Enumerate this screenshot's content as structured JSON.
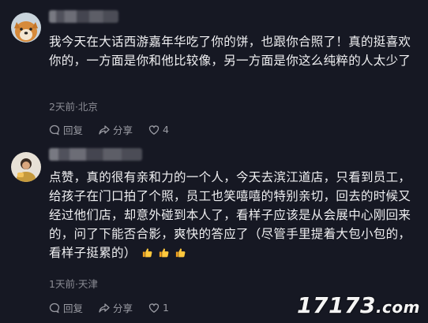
{
  "comments": [
    {
      "text": "我今天在大话西游嘉年华吃了你的饼，也跟你合照了！真的挺喜欢你的，一方面是你和他比较像，另一方面是你这么纯粹的人太少了",
      "meta": "2天前·北京",
      "reply_label": "回复",
      "share_label": "分享",
      "like_count": "4"
    },
    {
      "text": "点赞，真的很有亲和力的一个人，今天去滨江道店，只看到员工，给孩子在门口拍了个照，员工也笑嘻嘻的特别亲切，回去的时候又经过他们店，却意外碰到本人了，看样子应该是从会展中心刚回来的，问了下能否合影，爽快的答应了（尽管手里提着大包小包的，看样子挺累的）",
      "meta": "1天前·天津",
      "reply_label": "回复",
      "share_label": "分享",
      "like_count": "1"
    }
  ],
  "watermark": {
    "main": "17173",
    "domain": ".com"
  },
  "icons": [
    "comment-icon",
    "share-icon",
    "heart-icon",
    "thumbs-up-emoji"
  ]
}
